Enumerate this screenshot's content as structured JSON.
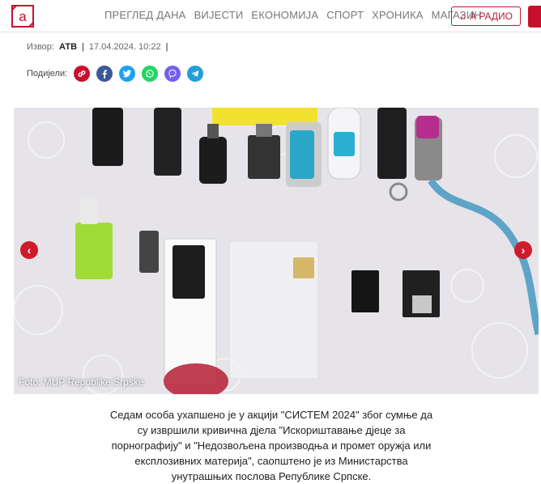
{
  "header": {
    "logo_letter": "a",
    "nav": [
      "ПРЕГЛЕД ДАНА",
      "ВИЈЕСТИ",
      "ЕКОНОМИЈА",
      "СПОРТ",
      "ХРОНИКА",
      "МАГАЗИН"
    ],
    "radio_label": "А РАДИО",
    "radio_icon": "music-note-icon",
    "accent": "#c8102e"
  },
  "meta": {
    "source_label": "Извор:",
    "source": "АТВ",
    "date": "17.04.2024. 10:22"
  },
  "share": {
    "label": "Подијели:",
    "icons": [
      "link-icon",
      "facebook-icon",
      "twitter-icon",
      "whatsapp-icon",
      "viber-icon",
      "telegram-icon"
    ]
  },
  "photo": {
    "caption": "Foto: MUP Republike Srpske"
  },
  "article": {
    "text": "Седам особа ухапшено је у акцији \"СИСТЕМ 2024\" због сумње да су извршили кривична дјела \"Искориштавање дјеце за порнографију\" и \"Недозвољена производња и промет оружја или експлозивних материја\", саопштено је из Министарства унутрашњих послова Републике Српске."
  }
}
